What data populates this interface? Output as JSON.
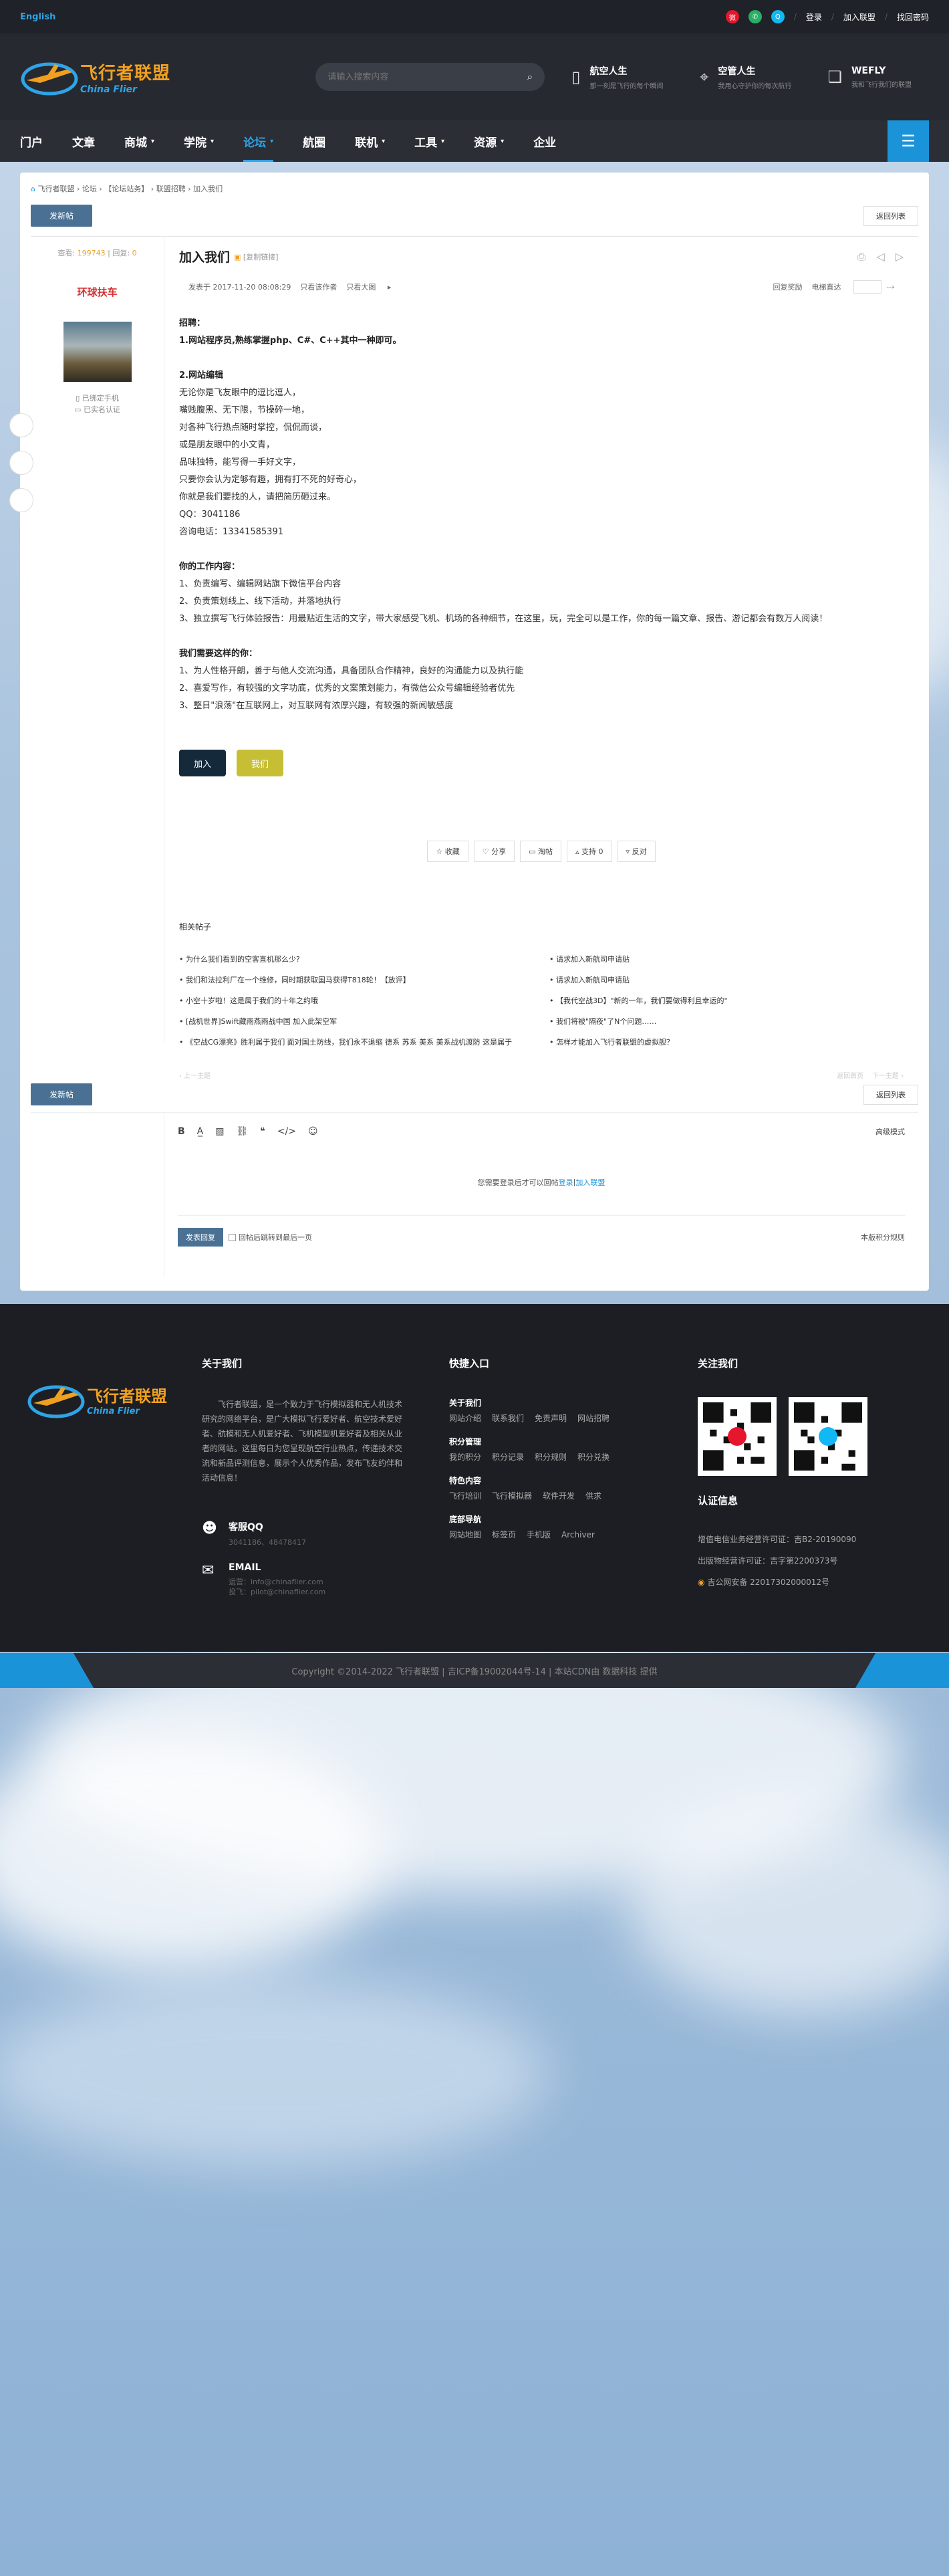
{
  "topbar": {
    "lang": "English",
    "login": "登录",
    "join": "加入联盟",
    "forgot": "找回密码",
    "social": [
      {
        "name": "weibo-icon",
        "color": "#e6162d",
        "glyph": "微"
      },
      {
        "name": "wechat-icon",
        "color": "#2aae67",
        "glyph": "微"
      },
      {
        "name": "qq-icon",
        "color": "#12b7f5",
        "glyph": "Q"
      }
    ]
  },
  "header": {
    "logo_cn": "飞行者联盟",
    "logo_en": "China Flier",
    "search_placeholder": "请输入搜索内容",
    "blocks": [
      {
        "title": "航空人生",
        "sub": "那一刻是飞行的每个瞬间"
      },
      {
        "title": "空管人生",
        "sub": "我用心守护你的每次航行"
      },
      {
        "title": "WEFLY",
        "sub": "我和飞行我们的联盟"
      }
    ]
  },
  "nav": {
    "items": [
      {
        "label": "门户",
        "caret": false,
        "active": false
      },
      {
        "label": "文章",
        "caret": false,
        "active": false
      },
      {
        "label": "商城",
        "caret": true,
        "active": false
      },
      {
        "label": "学院",
        "caret": true,
        "active": false
      },
      {
        "label": "论坛",
        "caret": true,
        "active": true
      },
      {
        "label": "航圈",
        "caret": false,
        "active": false
      },
      {
        "label": "联机",
        "caret": true,
        "active": false
      },
      {
        "label": "工具",
        "caret": true,
        "active": false
      },
      {
        "label": "资源",
        "caret": true,
        "active": false
      },
      {
        "label": "企业",
        "caret": false,
        "active": false
      }
    ]
  },
  "breadcrumb": [
    "飞行者联盟",
    "论坛",
    "【论坛站务】",
    "联盟招聘",
    "加入我们"
  ],
  "buttons": {
    "new_post": "发新帖",
    "back_list": "返回列表"
  },
  "author": {
    "stats_label_1": "查看:",
    "views": "199743",
    "stats_label_2": "回复:",
    "replies": "0",
    "name": "环球扶车",
    "verify_phone": "已绑定手机",
    "verify_real": "已实名认证"
  },
  "post": {
    "title": "加入我们",
    "tag": "[复制链接]",
    "meta_date": "发表于 2017-11-20 08:08:29",
    "meta_author": "只看该作者",
    "meta_big": "只看大图",
    "meta_reply": "回复奖励",
    "meta_mode": "电梯直达",
    "body": [
      {
        "t": "招聘：",
        "b": true
      },
      {
        "t": "1.网站程序员,熟练掌握php、C#、C++其中一种即可。",
        "b": true
      },
      {
        "t": "",
        "gap": true
      },
      {
        "t": "2.网站编辑",
        "b": true
      },
      {
        "t": "无论你是飞友眼中的逗比逗人，"
      },
      {
        "t": "嘴贱腹黑、无下限，节操碎一地，"
      },
      {
        "t": "对各种飞行热点随时掌控，侃侃而谈，"
      },
      {
        "t": "或是朋友眼中的小文青，"
      },
      {
        "t": "品味独特，能写得一手好文字，"
      },
      {
        "t": "只要你会认为定够有趣，拥有打不死的好奇心，"
      },
      {
        "t": "你就是我们要找的人，请把简历砸过来。"
      },
      {
        "t": "QQ：3041186"
      },
      {
        "t": "咨询电话：13341585391"
      },
      {
        "t": "",
        "gap": true
      },
      {
        "t": "你的工作内容：",
        "b": true
      },
      {
        "t": "1、负责编写、编辑网站旗下微信平台内容"
      },
      {
        "t": "2、负责策划线上、线下活动，并落地执行"
      },
      {
        "t": "3、独立撰写飞行体验报告：用最贴近生活的文字，带大家感受飞机、机场的各种细节，在这里，玩，完全可以是工作，你的每一篇文章、报告、游记都会有数万人阅读！"
      },
      {
        "t": "",
        "gap": true
      },
      {
        "t": "我们需要这样的你：",
        "b": true
      },
      {
        "t": "1、为人性格开朗，善于与他人交流沟通，具备团队合作精神，良好的沟通能力以及执行能"
      },
      {
        "t": "2、喜爱写作，有较强的文字功底，优秀的文案策划能力，有微信公众号编辑经验者优先"
      },
      {
        "t": "3、整日\"浪荡\"在互联网上，对互联网有浓厚兴趣，有较强的新闻敏感度"
      }
    ],
    "btn_join": "加入",
    "btn_we": "我们",
    "actions": [
      "☆ 收藏",
      "♡ 分享",
      "▭ 淘帖",
      "▵ 支持 0",
      "▿ 反对"
    ],
    "related_title": "相关帖子",
    "related": [
      "• 为什么我们看到的空客直机那么少?",
      "• 请求加入新航司申请贴",
      "• 我们和法拉利厂在一个维修，同时期获取国马获得T818轮！【放评】",
      "• 请求加入新航司申请贴",
      "• 小空十岁啦！这是属于我们的十年之约哦",
      "• 【我代空战3D】\"新的一年，我们要做得利且幸运的\"",
      "• [战机世界]Swift藏雨燕雨战中国 加入此架空军",
      "• 我们将被\"隔夜\"了N个问题……",
      "• 《空战CG漂亮》胜利属于我们 面对国土防线，我们永不退缩 德系 苏系 美系 美系战机渡防 这是属于",
      "• 怎样才能加入飞行者联盟的虚拟舰？"
    ],
    "prev": "‹ 上一主题",
    "next_1": "返回首页",
    "next_2": "下一主题 ›"
  },
  "reply": {
    "advanced": "高级模式",
    "notice_pre": "您需要登录后才可以回帖 ",
    "notice_login": "登录",
    "notice_sep": " | ",
    "notice_join": "加入联盟",
    "submit": "发表回复",
    "checkbox_label": "回帖后跳转到最后一页",
    "points": "本版积分规则"
  },
  "footer": {
    "about_title": "关于我们",
    "about_text": "飞行者联盟，是一个致力于飞行模拟器和无人机技术研究的网络平台，是广大模拟飞行爱好者、航空技术爱好者、航模和无人机爱好者、飞机模型机爱好者及相关从业者的网站。这里每日为您呈现航空行业热点，传递技术交流和新品评测信息，展示个人优秀作品，发布飞友约伴和活动信息！",
    "qq_title": "客服QQ",
    "qq_value": "3041186、48478417",
    "email_title": "EMAIL",
    "email_1": "运营：info@chinaflier.com",
    "email_2": "投飞：pilot@chinaflier.com",
    "quick_title": "快捷入口",
    "groups": [
      {
        "h": "关于我们",
        "links": [
          "网站介绍",
          "联系我们",
          "免责声明",
          "网站招聘"
        ]
      },
      {
        "h": "积分管理",
        "links": [
          "我的积分",
          "积分记录",
          "积分规则",
          "积分兑换"
        ]
      },
      {
        "h": "特色内容",
        "links": [
          "飞行培训",
          "飞行模拟器",
          "软件开发",
          "供求"
        ]
      },
      {
        "h": "底部导航",
        "links": [
          "网站地图",
          "标签页",
          "手机版",
          "Archiver"
        ]
      }
    ],
    "follow_title": "关注我们",
    "cert_title": "认证信息",
    "cert_1": "增值电信业务经营许可证：吉B2-20190090",
    "cert_2": "出版物经营许可证：吉字第2200373号",
    "cert_3": "吉公网安备 22017302000012号",
    "copyright": "Copyright ©2014-2022 飞行者联盟 | 吉ICP备19002044号-14 | 本站CDN由 数据科技 提供"
  },
  "colors": {
    "accent": "#1a93d9",
    "dark": "#1f2228",
    "author": "#d32f2f",
    "gold": "#f0a020"
  }
}
